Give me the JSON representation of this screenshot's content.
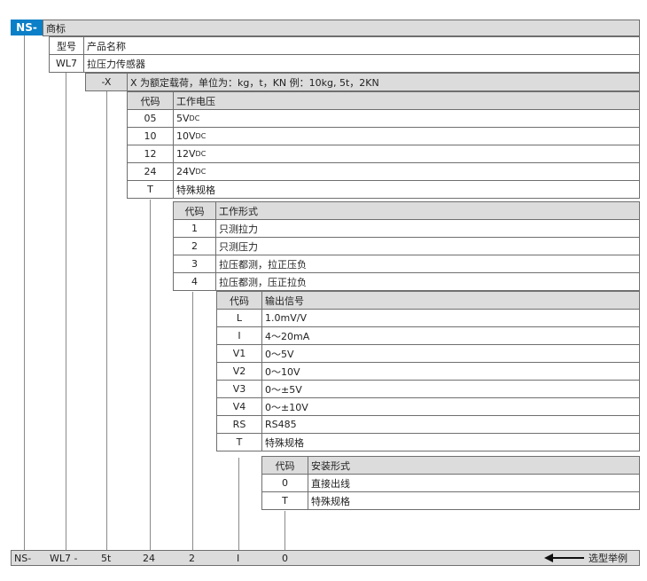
{
  "badge": "NS-",
  "level1": {
    "label": "商标"
  },
  "level2": {
    "code": "型号",
    "label": "产品名称"
  },
  "level3": {
    "code": "WL7",
    "label": "拉压力传感器"
  },
  "level4": {
    "code": "-X",
    "label": "X 为额定载荷，单位为：kg，t，KN 例：10kg, 5t，2KN"
  },
  "voltage": {
    "header": {
      "code": "代码",
      "label": "工作电压"
    },
    "rows": [
      {
        "code": "05",
        "value": "5V",
        "sub": "DC"
      },
      {
        "code": "10",
        "value": "10V",
        "sub": "DC"
      },
      {
        "code": "12",
        "value": "12V",
        "sub": "DC"
      },
      {
        "code": "24",
        "value": "24V",
        "sub": "DC"
      },
      {
        "code": "T",
        "value": "特殊规格",
        "sub": ""
      }
    ]
  },
  "mode": {
    "header": {
      "code": "代码",
      "label": "工作形式"
    },
    "rows": [
      {
        "code": "1",
        "label": "只测拉力"
      },
      {
        "code": "2",
        "label": "只测压力"
      },
      {
        "code": "3",
        "label": "拉压都测，拉正压负"
      },
      {
        "code": "4",
        "label": "拉压都测，压正拉负"
      }
    ]
  },
  "signal": {
    "header": {
      "code": "代码",
      "label": "输出信号"
    },
    "rows": [
      {
        "code": "L",
        "label": "1.0mV/V"
      },
      {
        "code": "I",
        "label": "4～20mA"
      },
      {
        "code": "V1",
        "label": "0～5V"
      },
      {
        "code": "V2",
        "label": "0～10V"
      },
      {
        "code": "V3",
        "label": "0～±5V"
      },
      {
        "code": "V4",
        "label": "0～±10V"
      },
      {
        "code": "RS",
        "label": "RS485"
      },
      {
        "code": "T",
        "label": "特殊规格"
      }
    ]
  },
  "install": {
    "header": {
      "code": "代码",
      "label": "安装形式"
    },
    "rows": [
      {
        "code": "0",
        "label": "直接出线"
      },
      {
        "code": "T",
        "label": "特殊规格"
      }
    ]
  },
  "example": {
    "parts": [
      "NS-",
      "WL7 -",
      "5t",
      "24",
      "2",
      "I",
      "0"
    ],
    "caption": "选型举例"
  },
  "colors": {
    "badge": "#0b7fc7",
    "header_bg": "#dcdcdc",
    "border": "#6f6f6f"
  }
}
